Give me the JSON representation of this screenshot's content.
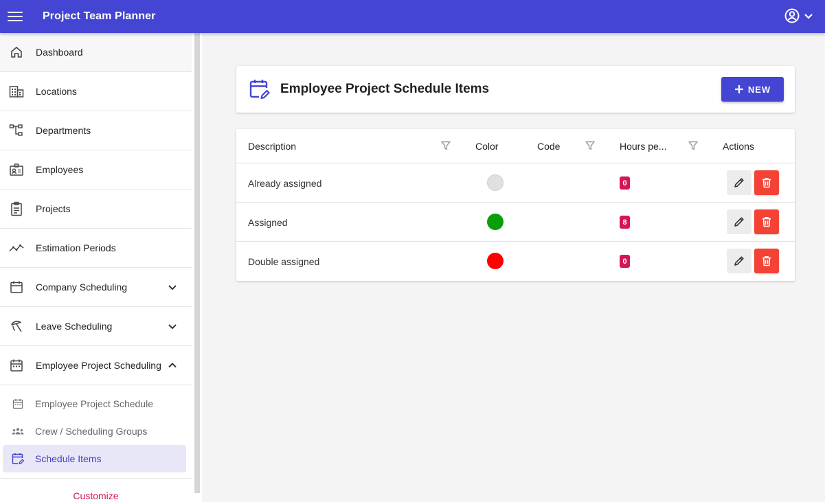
{
  "topbar": {
    "title": "Project Team Planner",
    "menu_icon": "hamburger-menu-icon",
    "account_icon": "account-circle-icon"
  },
  "sidebar": {
    "items": [
      {
        "label": "Dashboard",
        "icon": "home-icon"
      },
      {
        "label": "Locations",
        "icon": "building-icon"
      },
      {
        "label": "Departments",
        "icon": "org-chart-icon"
      },
      {
        "label": "Employees",
        "icon": "id-card-icon"
      },
      {
        "label": "Projects",
        "icon": "clipboard-icon"
      },
      {
        "label": "Estimation Periods",
        "icon": "trend-line-icon"
      },
      {
        "label": "Company Scheduling",
        "icon": "calendar-icon",
        "expandable": true,
        "expanded": false
      },
      {
        "label": "Leave Scheduling",
        "icon": "beach-umbrella-icon",
        "expandable": true,
        "expanded": false
      },
      {
        "label": "Employee Project Scheduling",
        "icon": "calendar-icon",
        "expandable": true,
        "expanded": true
      }
    ],
    "sub_items": [
      {
        "label": "Employee Project Schedule",
        "icon": "calendar-icon",
        "active": false
      },
      {
        "label": "Crew / Scheduling Groups",
        "icon": "group-icon",
        "active": false
      },
      {
        "label": "Schedule Items",
        "icon": "calendar-edit-icon",
        "active": true
      }
    ],
    "customize_label": "Customize"
  },
  "header": {
    "title": "Employee Project Schedule Items",
    "icon": "calendar-edit-icon",
    "new_button_label": "NEW"
  },
  "table": {
    "columns": {
      "description": "Description",
      "color": "Color",
      "code": "Code",
      "hours": "Hours pe...",
      "actions": "Actions"
    },
    "rows": [
      {
        "description": "Already assigned",
        "color": "#e0e0e0",
        "code": "",
        "hours": "0"
      },
      {
        "description": "Assigned",
        "color": "#0a9f0a",
        "code": "",
        "hours": "8"
      },
      {
        "description": "Double assigned",
        "color": "#ff0000",
        "code": "",
        "hours": "0"
      }
    ]
  },
  "colors": {
    "primary": "#4545d3",
    "accent": "#d4155a",
    "danger": "#f44335",
    "active_bg": "#e8e7f8"
  }
}
